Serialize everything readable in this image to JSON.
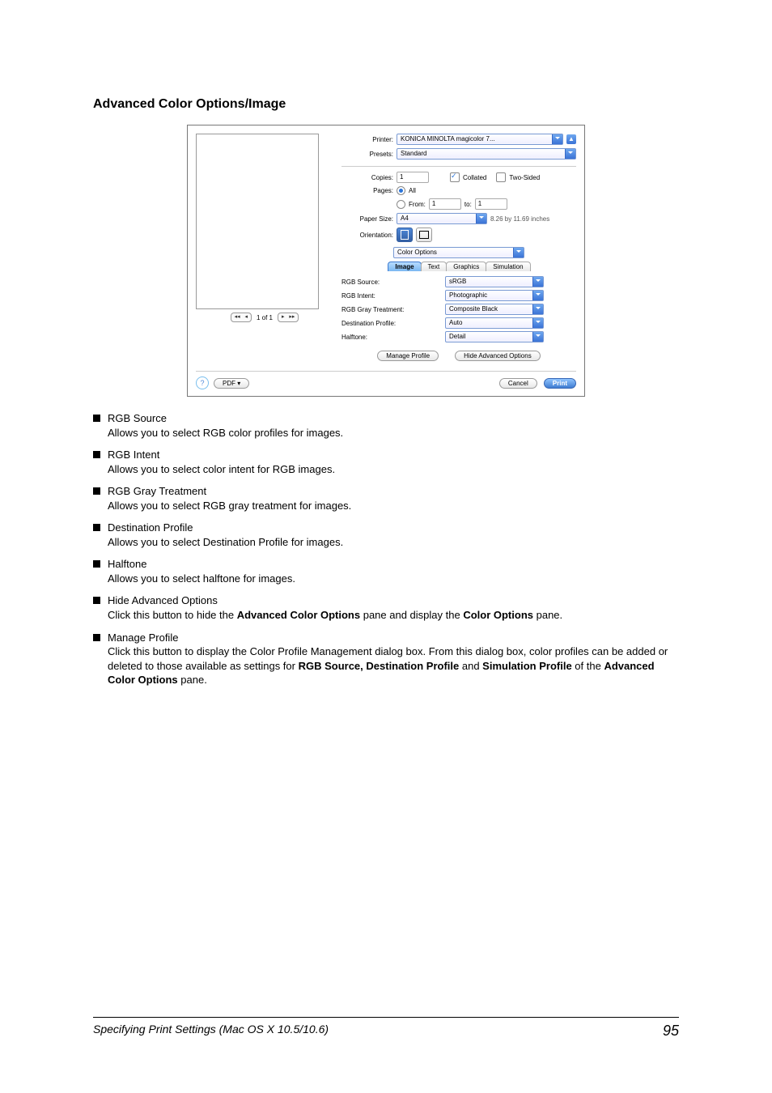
{
  "section_title": "Advanced Color Options/Image",
  "dialog": {
    "printer_label": "Printer:",
    "printer_value": "KONICA MINOLTA magicolor 7...",
    "presets_label": "Presets:",
    "presets_value": "Standard",
    "copies_label": "Copies:",
    "copies_value": "1",
    "collated_label": "Collated",
    "twosided_label": "Two-Sided",
    "pages_label": "Pages:",
    "pages_all": "All",
    "pages_from": "From:",
    "pages_from_value": "1",
    "pages_to": "to:",
    "pages_to_value": "1",
    "paper_label": "Paper Size:",
    "paper_value": "A4",
    "paper_dims": "8.26 by 11.69 inches",
    "orient_label": "Orientation:",
    "pane_select": "Color Options",
    "tabs": {
      "image": "Image",
      "text": "Text",
      "graphics": "Graphics",
      "simulation": "Simulation"
    },
    "rgb_source_label": "RGB Source:",
    "rgb_source_value": "sRGB",
    "rgb_intent_label": "RGB Intent:",
    "rgb_intent_value": "Photographic",
    "rgb_gray_label": "RGB Gray Treatment:",
    "rgb_gray_value": "Composite Black",
    "dest_profile_label": "Destination Profile:",
    "dest_profile_value": "Auto",
    "halftone_label": "Halftone:",
    "halftone_value": "Detail",
    "manage_profile_btn": "Manage Profile",
    "hide_advanced_btn": "Hide Advanced Options",
    "preview_nav": "1 of 1",
    "pdf_btn": "PDF ▾",
    "cancel_btn": "Cancel",
    "print_btn": "Print"
  },
  "bullets": [
    {
      "title": "RGB Source",
      "body": "Allows you to select RGB color profiles for images."
    },
    {
      "title": "RGB Intent",
      "body": "Allows you to select color intent for RGB images."
    },
    {
      "title": "RGB Gray Treatment",
      "body": "Allows you to select RGB gray treatment for images."
    },
    {
      "title": "Destination Profile",
      "body": "Allows you to select Destination Profile for images."
    },
    {
      "title": "Halftone",
      "body": "Allows you to select halftone for images."
    }
  ],
  "bullet_hide": {
    "title": "Hide Advanced Options",
    "prefix": "Click this button to hide the ",
    "bold1": "Advanced Color Options",
    "mid": " pane and display the ",
    "bold2": "Color Options",
    "suffix": " pane."
  },
  "bullet_manage": {
    "title": "Manage Profile",
    "line1": "Click this button to display the Color Profile Management dialog box. From this dialog box, color profiles can be added or deleted to those available as settings for ",
    "bold1": "RGB Source, Destination Profile",
    "mid1": " and ",
    "bold2": "Simulation Profile",
    "mid2": " of the ",
    "bold3": "Advanced Color Options",
    "suffix": " pane."
  },
  "footer": {
    "text": "Specifying Print Settings (Mac OS X 10.5/10.6)",
    "page": "95"
  }
}
